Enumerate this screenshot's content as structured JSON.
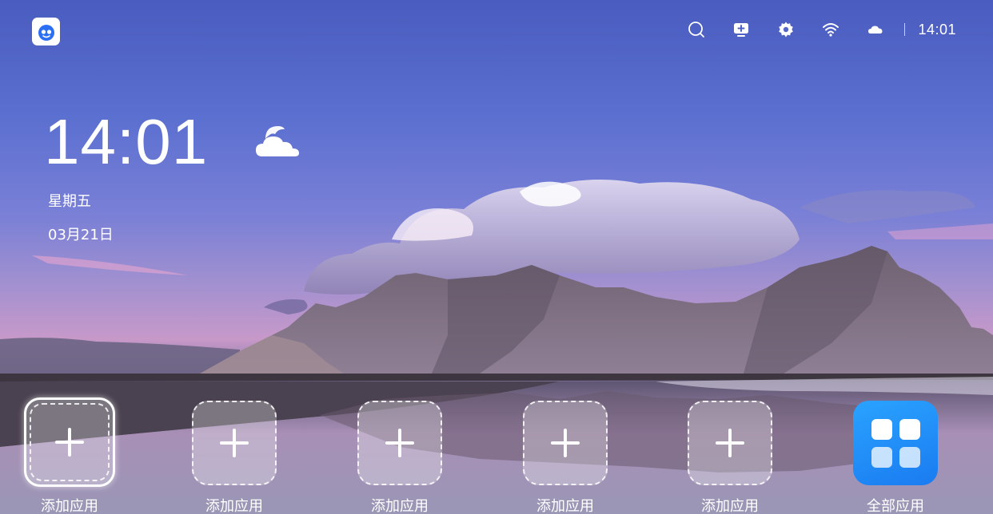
{
  "statusbar": {
    "time": "14:01",
    "icons": [
      "search-icon",
      "screen-cast-icon",
      "settings-gear-icon",
      "wifi-icon",
      "cloud-weather-icon"
    ]
  },
  "clock_widget": {
    "time": "14:01",
    "weekday": "星期五",
    "date": "03月21日",
    "weather_icon": "cloudy-icon"
  },
  "dock": {
    "slots": [
      {
        "label": "添加应用",
        "icon": "plus-icon"
      },
      {
        "label": "添加应用",
        "icon": "plus-icon"
      },
      {
        "label": "添加应用",
        "icon": "plus-icon"
      },
      {
        "label": "添加应用",
        "icon": "plus-icon"
      },
      {
        "label": "添加应用",
        "icon": "plus-icon"
      }
    ],
    "all_apps": {
      "label": "全部应用",
      "icon": "app-grid-icon",
      "color": "#1f8cf8"
    }
  },
  "colors": {
    "sky_top": "#4a5cbf",
    "horizon": "#c799c9",
    "accent": "#1f8cf8",
    "logo": "#2b6ff2"
  }
}
